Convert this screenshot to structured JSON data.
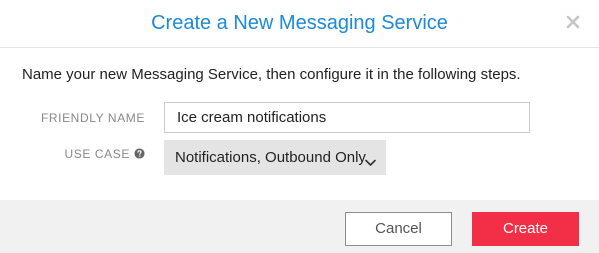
{
  "modal": {
    "title": "Create a New Messaging Service",
    "close_icon": "close-icon",
    "intro": "Name your new Messaging Service, then configure it in the following steps."
  },
  "form": {
    "friendly_name": {
      "label": "FRIENDLY NAME",
      "value": "Ice cream notifications"
    },
    "use_case": {
      "label": "USE CASE",
      "help_icon": "question-circle-icon",
      "selected": "Notifications, Outbound Only",
      "chevron_icon": "chevron-down-icon"
    }
  },
  "footer": {
    "cancel_label": "Cancel",
    "create_label": "Create"
  },
  "colors": {
    "title": "#1b8ad8",
    "primary_button": "#f22f46",
    "footer_bg": "#f1f1f1",
    "select_bg": "#e4e4e4"
  }
}
